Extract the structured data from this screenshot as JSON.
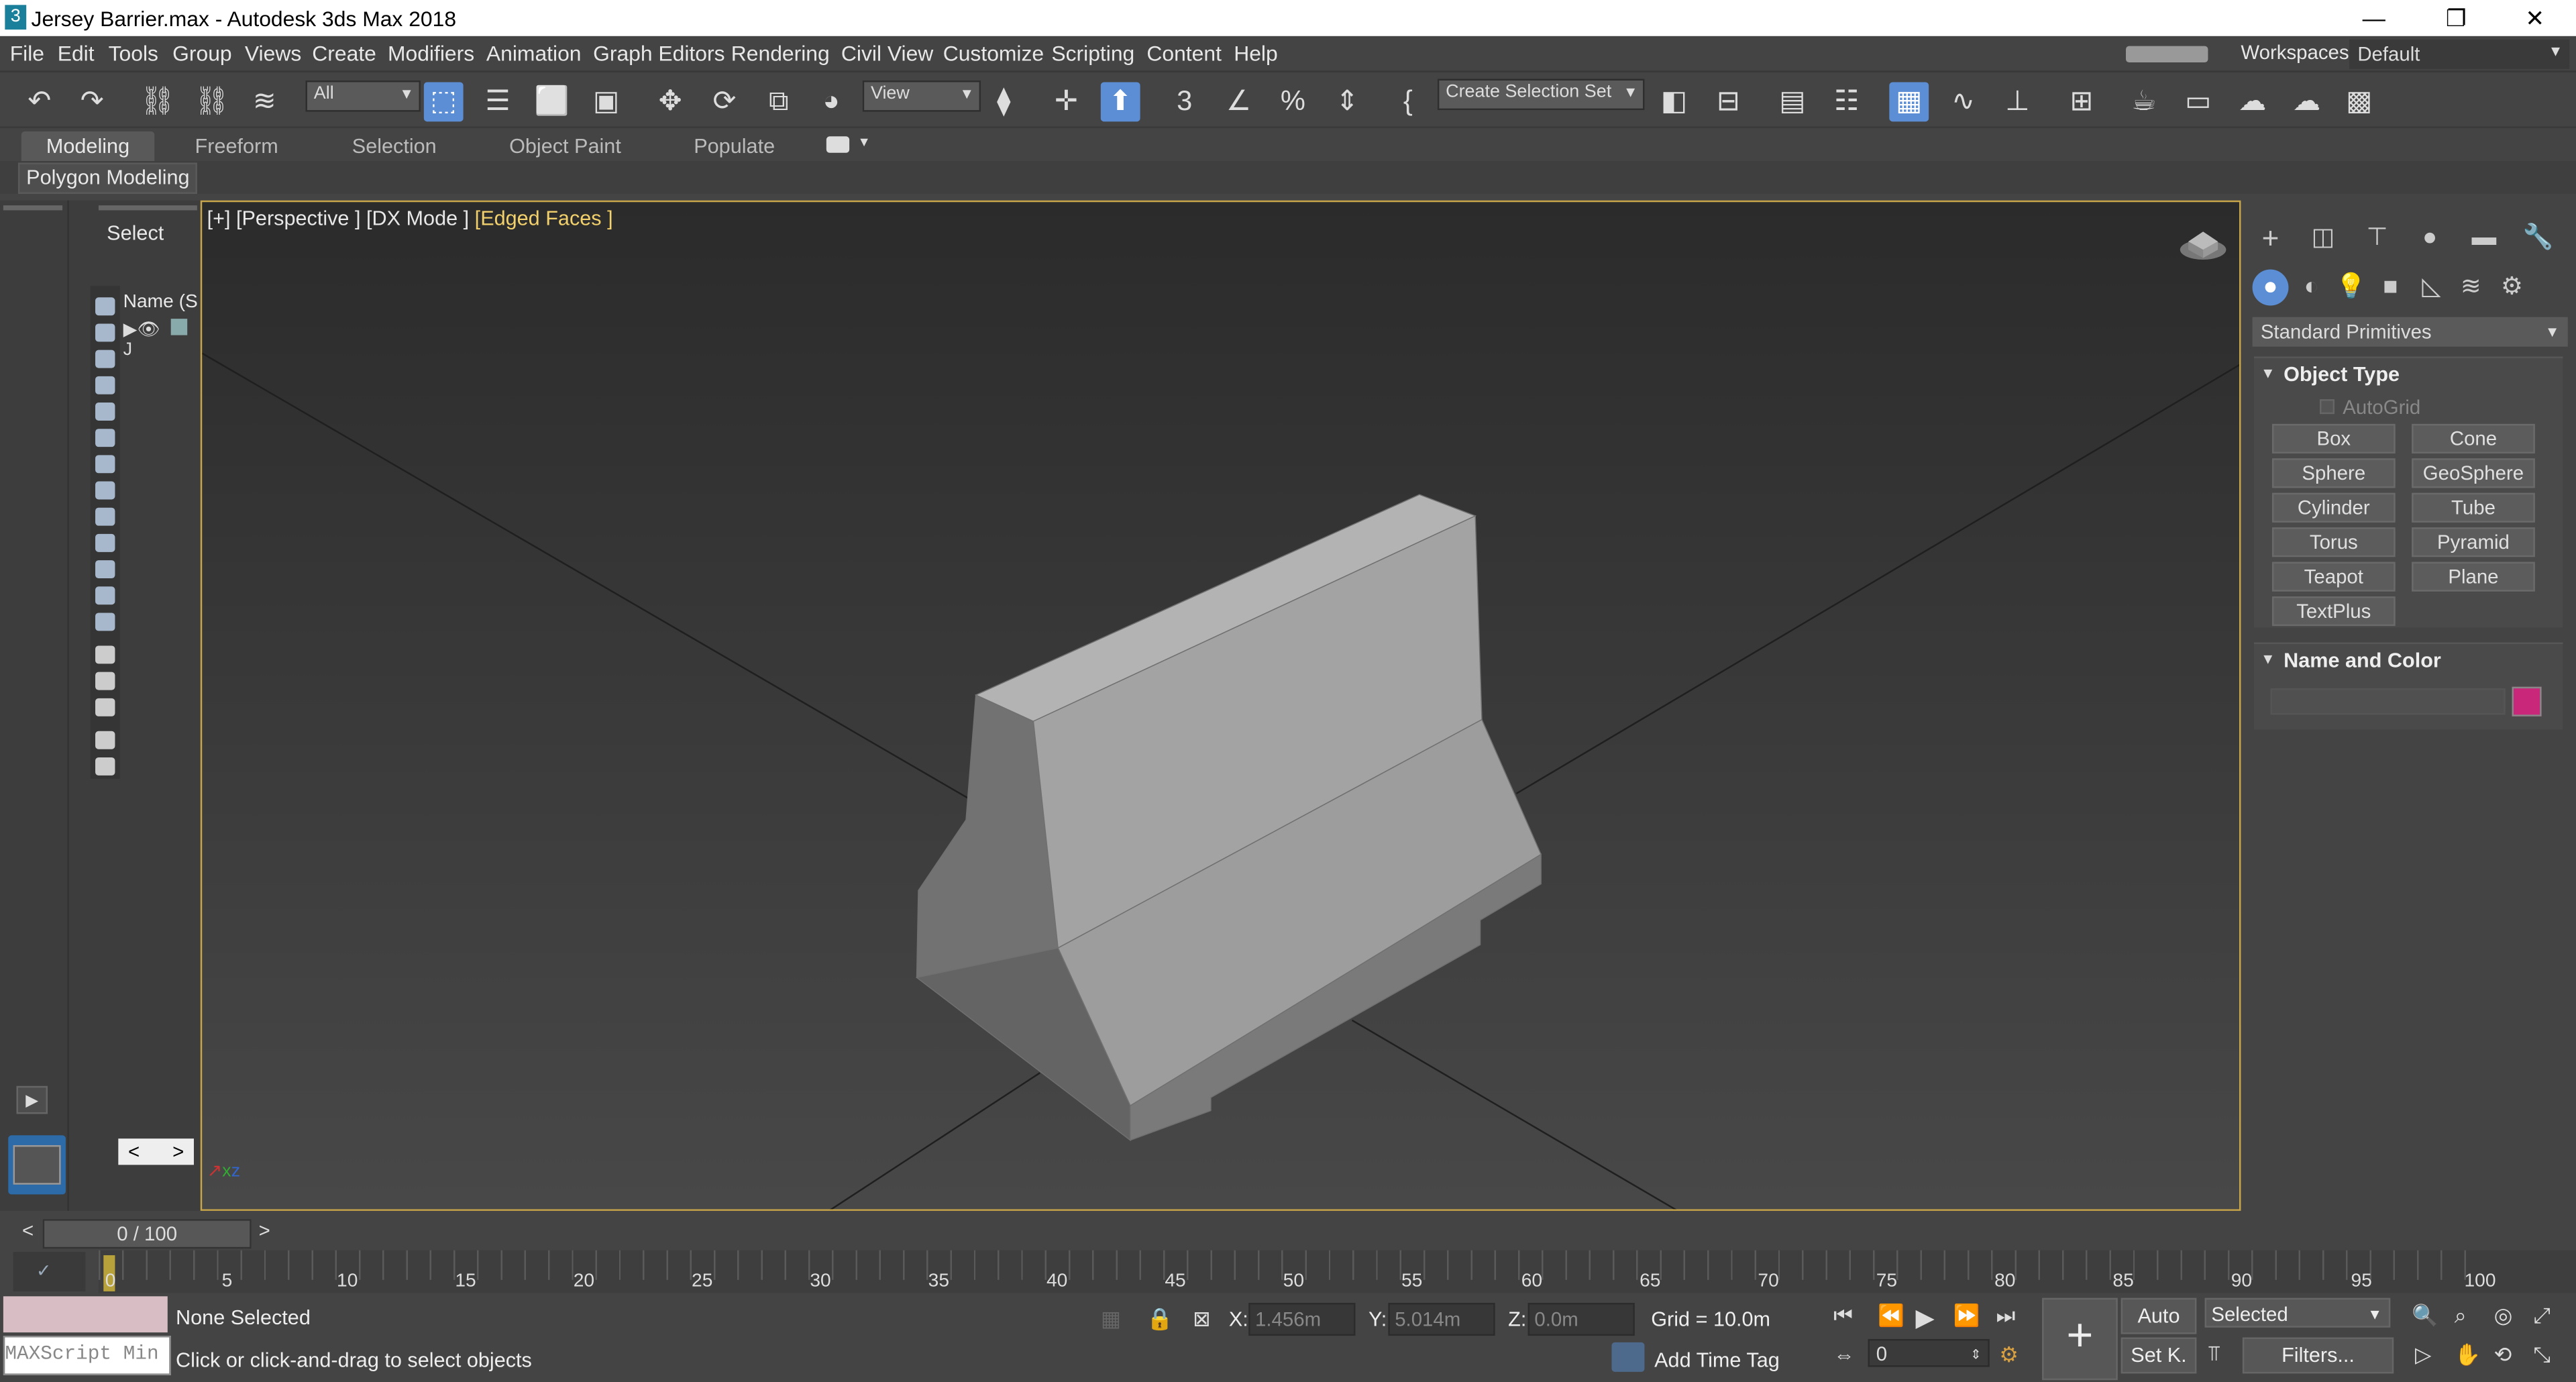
{
  "window": {
    "title": "Jersey Barrier.max - Autodesk 3ds Max 2018",
    "app_icon": "3",
    "minimize": "—",
    "restore": "❐",
    "close": "✕"
  },
  "menu": [
    "File",
    "Edit",
    "Tools",
    "Group",
    "Views",
    "Create",
    "Modifiers",
    "Animation",
    "Graph Editors",
    "Rendering",
    "Civil View",
    "Customize",
    "Scripting",
    "Content",
    "Help"
  ],
  "workspaces": {
    "label": "Workspaces:",
    "value": "Default"
  },
  "toolbar": {
    "selection_filter": "All",
    "ref_coord": "View",
    "selection_set": "Create Selection Set"
  },
  "ribbon": {
    "tabs": [
      "Modeling",
      "Freeform",
      "Selection",
      "Object Paint",
      "Populate"
    ],
    "active_tab": "Modeling",
    "panel": "Polygon Modeling"
  },
  "scene_explorer": {
    "title": "Select",
    "column_name": "Name (S",
    "row_label": "J"
  },
  "viewport": {
    "label_plus": "[+]",
    "label_view": "[Perspective ]",
    "label_mode": "[DX Mode ]",
    "label_shading": "[Edged Faces ]"
  },
  "command_panel": {
    "category": "Standard Primitives",
    "object_type": {
      "title": "Object Type",
      "autogrid": "AutoGrid",
      "buttons": [
        "Box",
        "Cone",
        "Sphere",
        "GeoSphere",
        "Cylinder",
        "Tube",
        "Torus",
        "Pyramid",
        "Teapot",
        "Plane",
        "TextPlus"
      ]
    },
    "name_color": {
      "title": "Name and Color",
      "name_value": "",
      "swatch_color": "#c8277a"
    }
  },
  "timeline": {
    "slider": "0 / 100",
    "ticks": [
      "0",
      "5",
      "10",
      "15",
      "20",
      "25",
      "30",
      "35",
      "40",
      "45",
      "50",
      "55",
      "60",
      "65",
      "70",
      "75",
      "80",
      "85",
      "90",
      "95",
      "100"
    ]
  },
  "status": {
    "selection": "None Selected",
    "prompt": "Click or click-and-drag to select objects",
    "maxscript": "MAXScript Min",
    "x_label": "X:",
    "x_value": "1.456m",
    "y_label": "Y:",
    "y_value": "5.014m",
    "z_label": "Z:",
    "z_value": "0.0m",
    "grid": "Grid = 10.0m",
    "add_time_tag": "Add Time Tag",
    "frame": "0",
    "auto_key": "Auto",
    "set_key": "Set K.",
    "key_filter": "Selected",
    "filters": "Filters..."
  }
}
